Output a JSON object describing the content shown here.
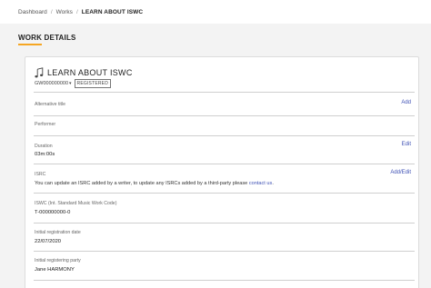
{
  "breadcrumb": {
    "items": [
      "Dashboard",
      "Works",
      "LEARN ABOUT ISWC"
    ],
    "separator": "/"
  },
  "page": {
    "title": "WORK DETAILS",
    "accent_color": "#f5a623"
  },
  "work": {
    "title": "LEARN ABOUT ISWC",
    "icon": "music-note-icon",
    "code": "GW000000000",
    "status_badge": "REGISTERED"
  },
  "fields": {
    "alternative_title": {
      "label": "Alternative title",
      "action": "Add"
    },
    "performer": {
      "label": "Performer"
    },
    "duration": {
      "label": "Duration",
      "value": "03m:00s",
      "action": "Edit"
    },
    "isrc": {
      "label": "ISRC",
      "action": "Add/Edit",
      "note": "You can update an ISRC added by a writer, to update any ISRCs added by a third-party please",
      "link": "contact us",
      "note_end": "."
    },
    "iswc": {
      "label": "ISWC (Int. Standard Music Work Code)",
      "value": "T-000000000-0"
    },
    "initial_registration_date": {
      "label": "Initial registration date",
      "value": "22/07/2020"
    },
    "initial_registering_party": {
      "label": "Initial registering party",
      "value": "Jane HARMONY"
    }
  },
  "colors": {
    "link": "#3f51b5",
    "background": "#f3f3f3",
    "card": "#ffffff"
  }
}
